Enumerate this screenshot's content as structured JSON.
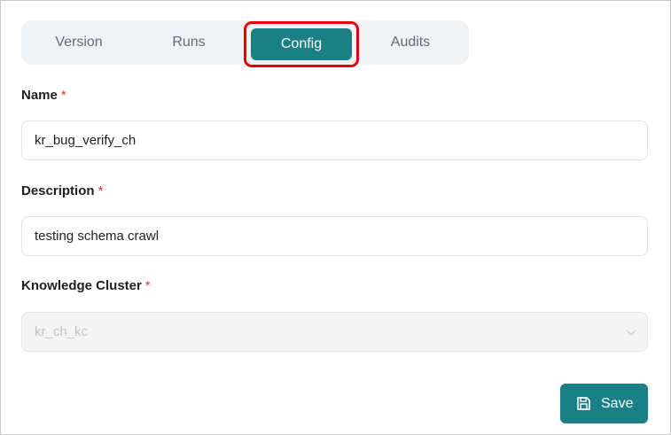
{
  "tabs": [
    {
      "label": "Version"
    },
    {
      "label": "Runs"
    },
    {
      "label": "Config"
    },
    {
      "label": "Audits"
    }
  ],
  "form": {
    "name": {
      "label": "Name",
      "required_mark": "*",
      "value": "kr_bug_verify_ch"
    },
    "description": {
      "label": "Description",
      "required_mark": "*",
      "value": "testing schema crawl"
    },
    "knowledge_cluster": {
      "label": "Knowledge Cluster",
      "required_mark": "*",
      "value": "kr_ch_kc",
      "icon": "chevron-down-icon"
    }
  },
  "actions": {
    "save_label": "Save",
    "save_icon": "save-icon"
  },
  "colors": {
    "accent": "#1b7f86",
    "highlight": "#e3000f",
    "required": "#e53935"
  }
}
